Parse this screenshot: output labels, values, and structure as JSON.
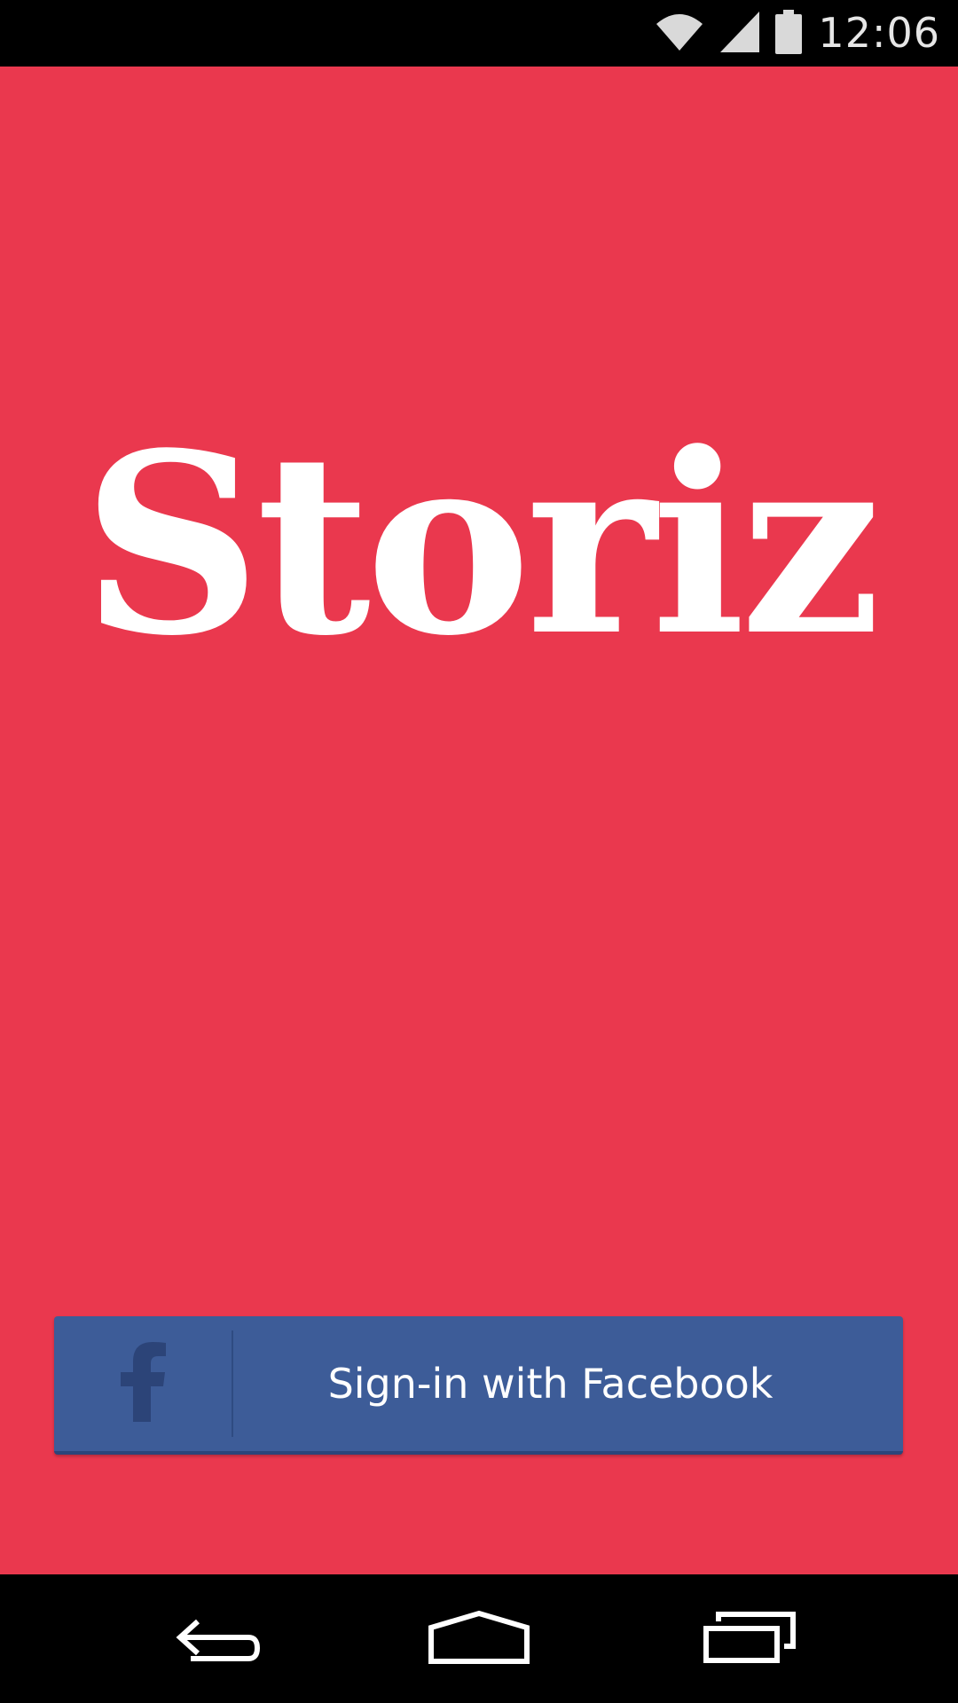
{
  "status_bar": {
    "time": "12:06",
    "icons": [
      "wifi-icon",
      "cell-signal-icon",
      "battery-icon"
    ]
  },
  "app": {
    "logo_text": "Storiz",
    "background_color": "#ea384e"
  },
  "login": {
    "facebook_button_label": "Sign-in with Facebook",
    "facebook_button_color": "#3d5c98",
    "facebook_icon": "facebook-f-icon"
  },
  "nav_bar": {
    "buttons": [
      "back-icon",
      "home-icon",
      "recents-icon"
    ]
  }
}
